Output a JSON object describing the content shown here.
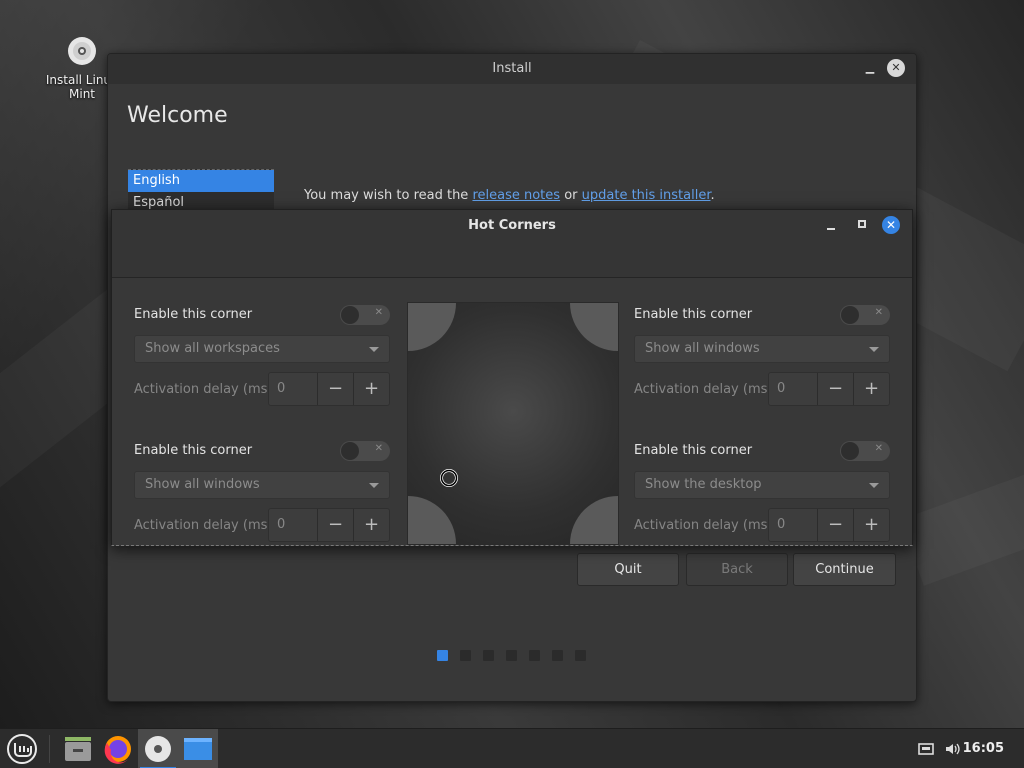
{
  "desktop": {
    "icon_label_line1": "Install Linux",
    "icon_label_line2": "Mint"
  },
  "install_window": {
    "title": "Install",
    "heading": "Welcome",
    "languages": [
      {
        "label": "English",
        "selected": true
      },
      {
        "label": "Español",
        "selected": false
      }
    ],
    "notes_prefix": "You may wish to read the ",
    "release_notes_link": "release notes",
    "notes_middle": " or ",
    "update_link": "update this installer",
    "notes_suffix": ".",
    "buttons": {
      "quit": "Quit",
      "back": "Back",
      "continue": "Continue"
    },
    "page_dots_total": 7,
    "page_dots_active": 1,
    "accent_color": "#3584e4"
  },
  "hot_corners": {
    "title": "Hot Corners",
    "corners": {
      "top_left": {
        "enable_label": "Enable this corner",
        "enabled": false,
        "action": "Show all workspaces",
        "delay_label": "Activation delay (ms)",
        "delay_value": "0"
      },
      "top_right": {
        "enable_label": "Enable this corner",
        "enabled": false,
        "action": "Show all windows",
        "delay_label": "Activation delay (ms)",
        "delay_value": "0"
      },
      "bottom_left": {
        "enable_label": "Enable this corner",
        "enabled": false,
        "action": "Show all windows",
        "delay_label": "Activation delay (ms)",
        "delay_value": "0"
      },
      "bottom_right": {
        "enable_label": "Enable this corner",
        "enabled": false,
        "action": "Show the desktop",
        "delay_label": "Activation delay (ms)",
        "delay_value": "0"
      }
    },
    "spin_minus": "−",
    "spin_plus": "+"
  },
  "taskbar": {
    "clock": "16:05",
    "icons": [
      "mint-menu-icon",
      "file-manager-icon",
      "firefox-icon",
      "installer-disc-icon",
      "desktop-window-icon"
    ]
  }
}
